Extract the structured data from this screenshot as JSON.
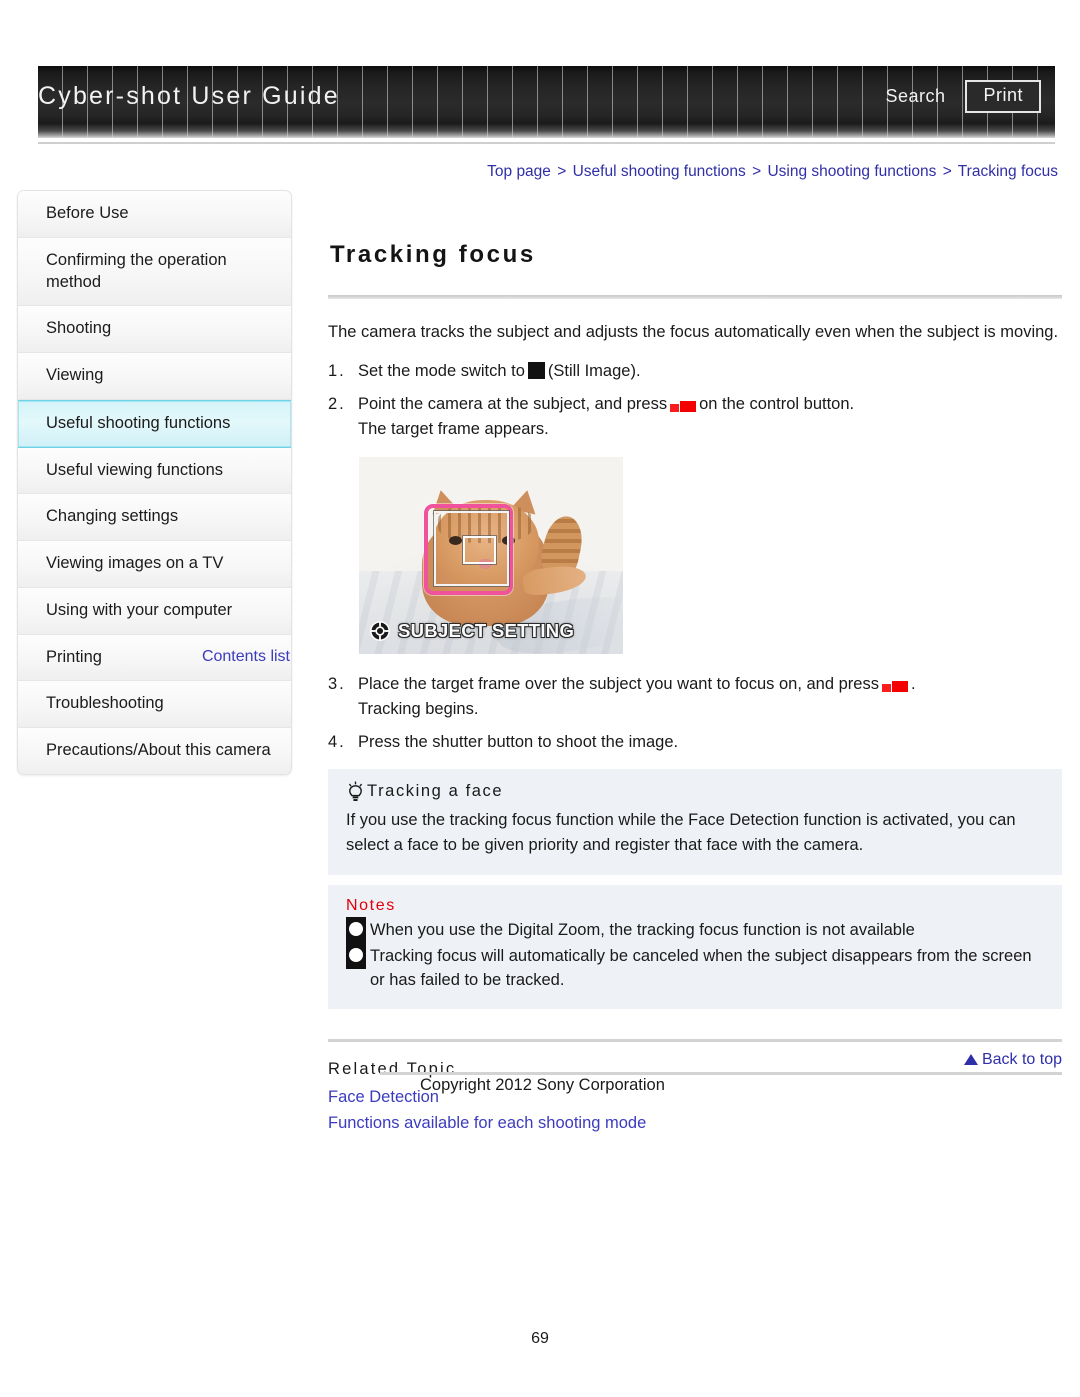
{
  "header": {
    "title": "Cyber-shot User Guide",
    "search_label": "Search",
    "print_label": "Print"
  },
  "breadcrumb": {
    "items": [
      "Top page",
      "Useful shooting functions",
      "Using shooting functions",
      "Tracking focus"
    ],
    "separator": ">"
  },
  "sidebar": {
    "items": [
      {
        "label": "Before Use",
        "active": false
      },
      {
        "label": "Confirming the operation method",
        "active": false
      },
      {
        "label": "Shooting",
        "active": false
      },
      {
        "label": "Viewing",
        "active": false
      },
      {
        "label": "Useful shooting functions",
        "active": true
      },
      {
        "label": "Useful viewing functions",
        "active": false
      },
      {
        "label": "Changing settings",
        "active": false
      },
      {
        "label": "Viewing images on a TV",
        "active": false
      },
      {
        "label": "Using with your computer",
        "active": false
      },
      {
        "label": "Printing",
        "active": false
      },
      {
        "label": "Troubleshooting",
        "active": false
      },
      {
        "label": "Precautions/About this camera",
        "active": false
      }
    ],
    "contents_list_label": "Contents list"
  },
  "main": {
    "title": "Tracking focus",
    "lead": "The camera tracks the subject and adjusts the focus automatically even when the subject is moving.",
    "steps": [
      {
        "number": "1.",
        "text_before": "Set the mode switch to",
        "icon": "still-image-icon",
        "text_after": "(Still Image).",
        "subline": ""
      },
      {
        "number": "2.",
        "text_before": "Point the camera at the subject, and press",
        "icon": "center-button-icon",
        "text_after": "on the control button.",
        "subline": "The target frame appears."
      },
      {
        "number": "3.",
        "text_before": "Place the target frame over the subject you want to focus on, and press",
        "icon": "center-button-icon",
        "text_after": ".",
        "subline": "Tracking begins."
      },
      {
        "number": "4.",
        "text_before": "Press the shutter button to shoot the image.",
        "icon": "",
        "text_after": "",
        "subline": ""
      }
    ],
    "camera_screen": {
      "osd_label": "SUBJECT SETTING",
      "osd_icon": "crosshair-icon",
      "target_frame_color": "#f0539c",
      "focus_frame_color": "#f3f3f3"
    },
    "tip": {
      "icon": "lightbulb-icon",
      "heading": "Tracking a face",
      "body": "If you use the tracking focus function while the Face Detection function is activated, you can select a face to be given priority and register that face with the camera."
    },
    "notes": {
      "title": "Notes",
      "title_color": "#e0000b",
      "items": [
        "When you use the Digital Zoom, the tracking focus function is not available",
        "Tracking focus will automatically be canceled when the subject disappears from the screen or has failed to be tracked."
      ]
    },
    "related": {
      "heading": "Related Topic",
      "links": [
        "Face Detection",
        "Functions available for each shooting mode"
      ]
    }
  },
  "footer": {
    "back_to_top": "Back to top",
    "copyright": "Copyright 2012 Sony Corporation",
    "page_number": "69"
  },
  "colors": {
    "link": "#3b3bbf",
    "breadcrumb": "#2f2fa8",
    "accent_red": "#e0000b",
    "highlight": "#d4f4f9",
    "box_bg": "#eef1f5"
  }
}
